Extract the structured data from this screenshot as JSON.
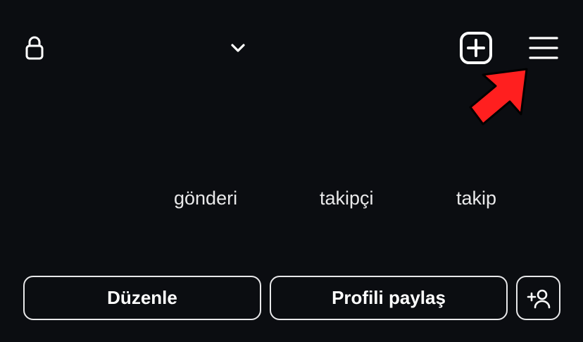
{
  "header": {
    "lock_icon": "lock-icon",
    "account_switcher_icon": "chevron-down-icon",
    "new_post_icon": "plus-square-icon",
    "menu_icon": "hamburger-menu-icon"
  },
  "stats": {
    "posts_label": "gönderi",
    "followers_label": "takipçi",
    "following_label": "takip"
  },
  "actions": {
    "edit_label": "Düzenle",
    "share_label": "Profili paylaş",
    "discover_people_icon": "add-person-icon"
  },
  "annotation": {
    "arrow_color": "#ff1f1f",
    "arrow_outline": "#000000"
  }
}
